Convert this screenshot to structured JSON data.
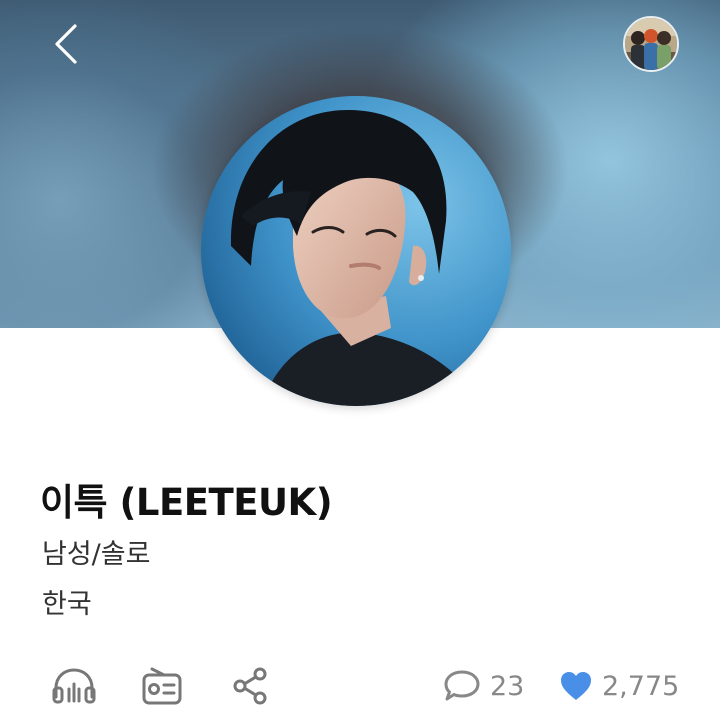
{
  "header": {
    "back_icon": "chevron-left-icon"
  },
  "artist": {
    "name": "이특 (LEETEUK)",
    "category": "남성/솔로",
    "country": "한국"
  },
  "actions": {
    "listen_icon": "headphones-icon",
    "radio_icon": "radio-icon",
    "share_icon": "share-icon"
  },
  "stats": {
    "comment_count": "23",
    "like_count": "2,775",
    "like_color": "#4a8fe7"
  }
}
